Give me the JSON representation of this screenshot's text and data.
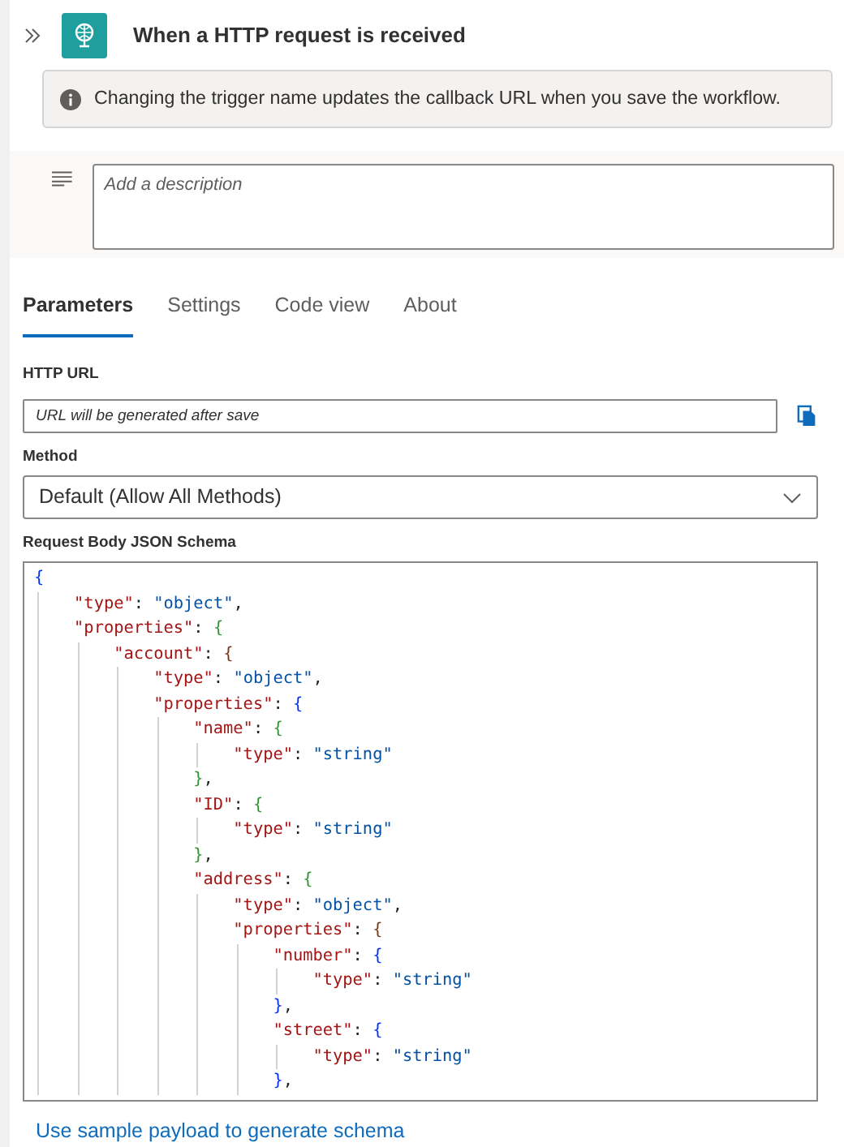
{
  "header": {
    "title": "When a HTTP request is received"
  },
  "info_bar": {
    "text": "Changing the trigger name updates the callback URL when you save the workflow."
  },
  "description": {
    "placeholder": "Add a description"
  },
  "tabs": [
    {
      "label": "Parameters",
      "selected": true
    },
    {
      "label": "Settings",
      "selected": false
    },
    {
      "label": "Code view",
      "selected": false
    },
    {
      "label": "About",
      "selected": false
    }
  ],
  "http_url": {
    "label": "HTTP URL",
    "value": "URL will be generated after save"
  },
  "method": {
    "label": "Method",
    "value": "Default (Allow All Methods)"
  },
  "schema": {
    "label": "Request Body JSON Schema",
    "lines": [
      "{",
      "    \"type\": \"object\",",
      "    \"properties\": {",
      "        \"account\": {",
      "            \"type\": \"object\",",
      "            \"properties\": {",
      "                \"name\": {",
      "                    \"type\": \"string\"",
      "                },",
      "                \"ID\": {",
      "                    \"type\": \"string\"",
      "                },",
      "                \"address\": {",
      "                    \"type\": \"object\",",
      "                    \"properties\": {",
      "                        \"number\": {",
      "                            \"type\": \"string\"",
      "                        },",
      "                        \"street\": {",
      "                            \"type\": \"string\"",
      "                        },"
    ]
  },
  "sample_link": "Use sample payload to generate schema"
}
